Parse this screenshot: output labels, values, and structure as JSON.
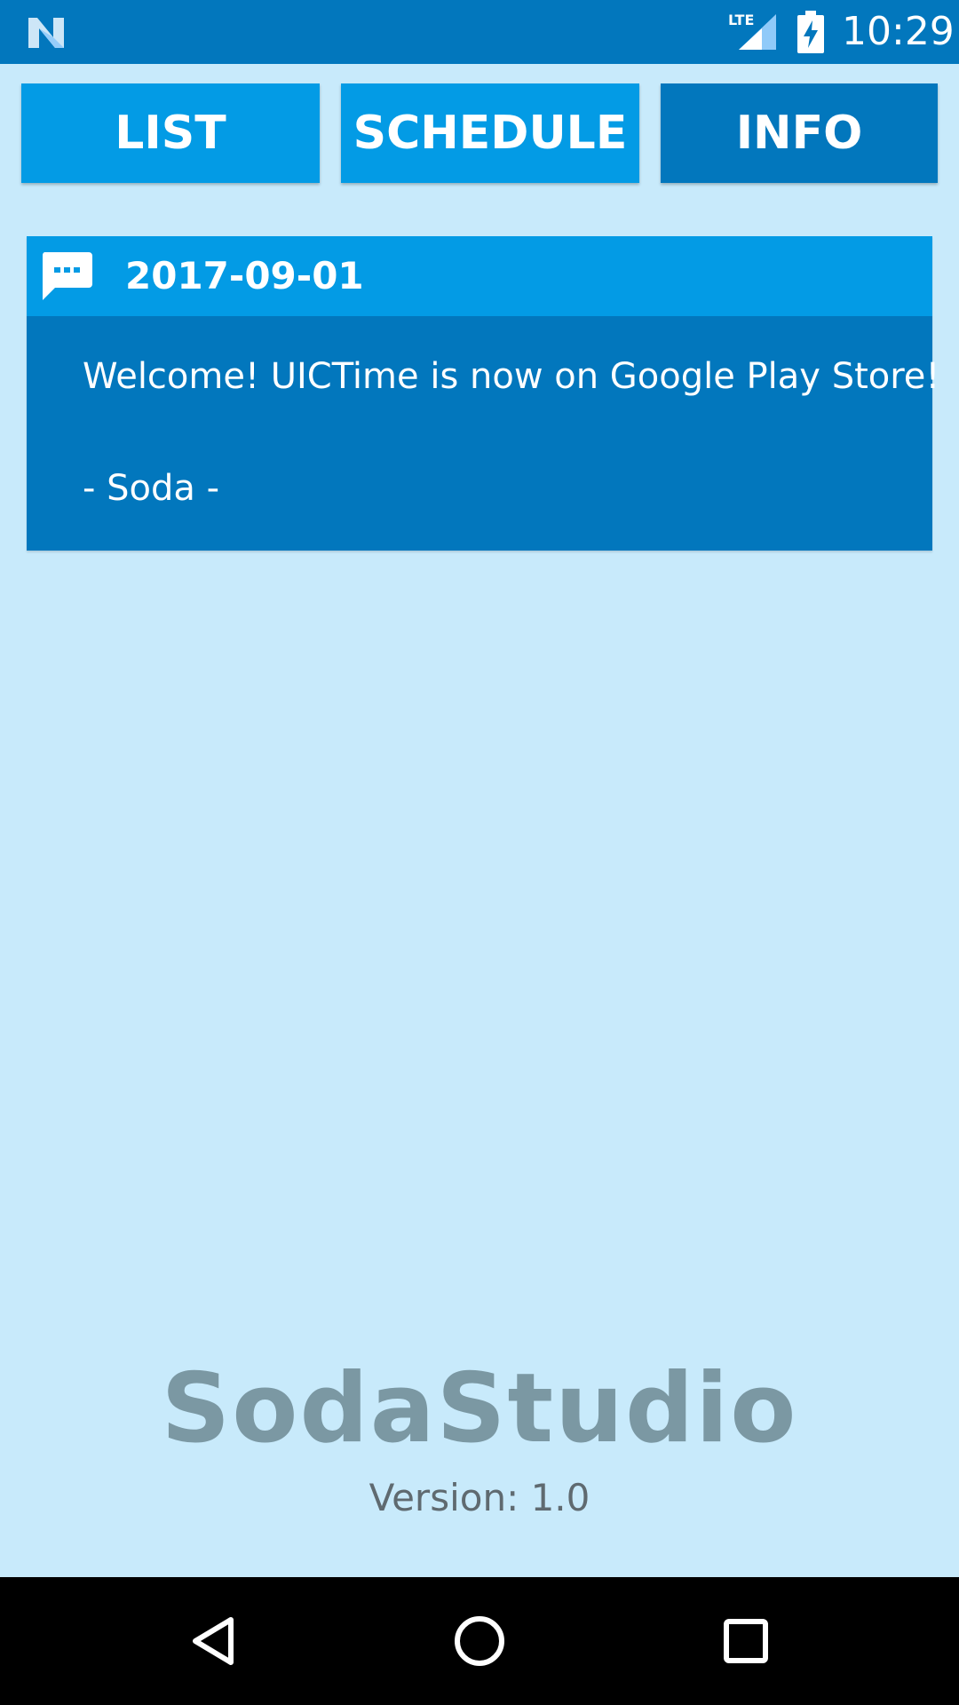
{
  "status_bar": {
    "notification_icon": "n-icon",
    "network_label": "LTE",
    "battery_icon": "battery-charging-icon",
    "time": "10:29"
  },
  "tabs": [
    {
      "label": "LIST",
      "selected": false
    },
    {
      "label": "SCHEDULE",
      "selected": false
    },
    {
      "label": "INFO",
      "selected": true
    }
  ],
  "notice": {
    "icon": "message-icon",
    "date": "2017-09-01",
    "lines": [
      "Welcome! UICTime is now on Google Play Store!",
      "- Soda -"
    ]
  },
  "footer": {
    "brand": "SodaStudio",
    "version": "Version: 1.0"
  },
  "nav_bar": {
    "back_icon": "back-icon",
    "home_icon": "home-icon",
    "recents_icon": "recents-icon"
  },
  "colors": {
    "background": "#c8eafb",
    "primary_dark": "#0277bd",
    "primary": "#039be5",
    "brand_text": "#7b98a3"
  }
}
